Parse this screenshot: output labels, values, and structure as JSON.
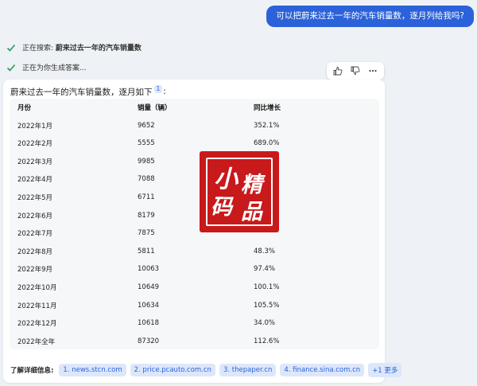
{
  "user_message": "可以把蔚来过去一年的汽车销量数，逐月列给我吗?",
  "status": [
    {
      "prefix": "正在搜索: ",
      "query": "蔚来过去一年的汽车销量数"
    },
    {
      "prefix": "正在为你生成答案...",
      "query": ""
    }
  ],
  "reactions": {
    "like": "thumbs-up-icon",
    "dislike": "thumbs-down-icon",
    "more": "more-icon"
  },
  "answer": {
    "intro": "蔚来过去一年的汽车销量数，逐月如下",
    "intro_cite": "1",
    "intro_suffix": ":",
    "table": {
      "headers": [
        "月份",
        "销量（辆）",
        "同比增长"
      ],
      "rows": [
        [
          "2022年1月",
          "9652",
          "352.1%"
        ],
        [
          "2022年2月",
          "5555",
          "689.0%"
        ],
        [
          "2022年3月",
          "9985",
          ""
        ],
        [
          "2022年4月",
          "7088",
          ""
        ],
        [
          "2022年5月",
          "6711",
          ""
        ],
        [
          "2022年6月",
          "8179",
          ""
        ],
        [
          "2022年7月",
          "7875",
          ""
        ],
        [
          "2022年8月",
          "5811",
          "48.3%"
        ],
        [
          "2022年9月",
          "10063",
          "97.4%"
        ],
        [
          "2022年10月",
          "10649",
          "100.1%"
        ],
        [
          "2022年11月",
          "10634",
          "105.5%"
        ],
        [
          "2022年12月",
          "10618",
          "34.0%"
        ],
        [
          "2022年全年",
          "87320",
          "112.6%"
        ]
      ]
    },
    "learn_more": {
      "label": "了解详细信息:",
      "links": [
        "1. news.stcn.com",
        "2. price.pcauto.com.cn",
        "3. thepaper.cn",
        "4. finance.sina.com.cn"
      ],
      "more": "+1 更多"
    }
  },
  "watermark": {
    "chars": [
      "小",
      "精",
      "码",
      "品"
    ]
  },
  "colors": {
    "accent": "#2b62d9",
    "check": "#1f9d55",
    "stamp": "#c8191b"
  }
}
